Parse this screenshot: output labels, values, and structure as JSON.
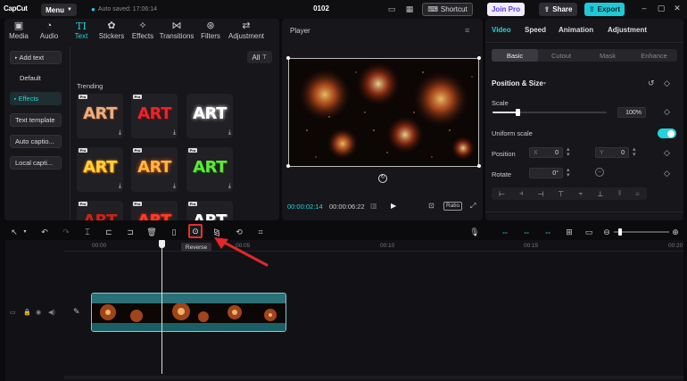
{
  "app": {
    "logo_text": "CapCut",
    "menu_label": "Menu",
    "autosave_text": "Auto saved: 17:06:14",
    "project_title": "0102",
    "shortcut_label": "Shortcut",
    "joinpro_label": "Join Pro",
    "share_label": "Share",
    "export_label": "Export"
  },
  "media_tabs": [
    {
      "label": "Media",
      "icon": "media-icon"
    },
    {
      "label": "Audio",
      "icon": "audio-icon"
    },
    {
      "label": "Text",
      "icon": "text-icon",
      "active": true
    },
    {
      "label": "Stickers",
      "icon": "stickers-icon"
    },
    {
      "label": "Effects",
      "icon": "effects-icon"
    },
    {
      "label": "Transitions",
      "icon": "transitions-icon"
    },
    {
      "label": "Filters",
      "icon": "filters-icon"
    },
    {
      "label": "Adjustment",
      "icon": "adjustment-icon"
    }
  ],
  "text_sidebar": [
    {
      "label": "Add text"
    },
    {
      "label": "Default"
    },
    {
      "label": "Effects"
    },
    {
      "label": "Text template"
    },
    {
      "label": "Auto captio..."
    },
    {
      "label": "Local capti..."
    }
  ],
  "filter_label": "All",
  "trending_label": "Trending",
  "art_tiles": [
    {
      "text": "ART",
      "style": "copper"
    },
    {
      "text": "ART",
      "style": "red"
    },
    {
      "text": "ART",
      "style": "white-glow"
    },
    {
      "text": "ART",
      "style": "gold"
    },
    {
      "text": "ART",
      "style": "orange-glow"
    },
    {
      "text": "ART",
      "style": "green"
    },
    {
      "text": "ART",
      "style": "red-dark"
    },
    {
      "text": "ART",
      "style": "red-glow"
    },
    {
      "text": "ART",
      "style": "white-3d"
    }
  ],
  "player": {
    "title": "Player",
    "current_time": "00:00:02:14",
    "total_time": "00:00:06:22",
    "ratio_label": "Ratio"
  },
  "right_panel": {
    "tabs": [
      "Video",
      "Speed",
      "Animation",
      "Adjustment"
    ],
    "subtabs": [
      "Basic",
      "Cutout",
      "Mask",
      "Enhance"
    ],
    "position_size_title": "Position & Size",
    "scale_label": "Scale",
    "scale_value": "100%",
    "scale_fraction": 0.22,
    "uniform_scale_label": "Uniform scale",
    "uniform_scale_on": true,
    "position_label": "Position",
    "x_label": "X",
    "x_value": "0",
    "y_label": "Y",
    "y_value": "0",
    "rotate_label": "Rotate",
    "rotate_value": "0°"
  },
  "timeline": {
    "reverse_tooltip": "Reverse",
    "ruler": [
      "00:00",
      "00:05",
      "00:10",
      "00:15",
      "00:20"
    ]
  },
  "colors": {
    "accent": "#22d3dc",
    "highlight": "#e03030",
    "export_bg": "#20c9d6",
    "joinpro_text": "#5a3bd6"
  }
}
